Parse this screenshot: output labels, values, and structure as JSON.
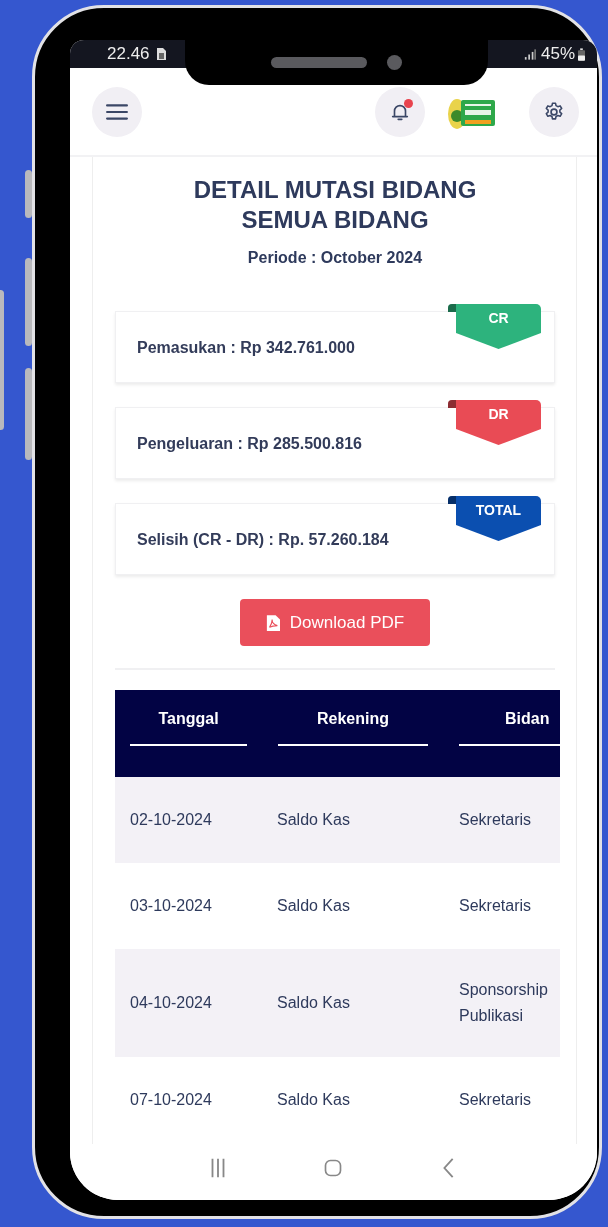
{
  "status_bar": {
    "time": "22.46",
    "battery": "45%"
  },
  "header": {
    "notification_unread": true
  },
  "report": {
    "title": "DETAIL MUTASI BIDANG",
    "subtitle": "SEMUA BIDANG",
    "period": "Periode : October 2024"
  },
  "summary": [
    {
      "text": "Pemasukan : Rp 342.761.000",
      "tag": "CR",
      "color": "#2db37d"
    },
    {
      "text": "Pengeluaran : Rp 285.500.816",
      "tag": "DR",
      "color": "#e94b55"
    },
    {
      "text": "Selisih (CR - DR) : Rp. 57.260.184",
      "tag": "TOTAL",
      "color": "#0b4fb0"
    }
  ],
  "download_button": "Download PDF",
  "table": {
    "columns": [
      "Tanggal",
      "Rekening",
      "Bidan"
    ],
    "rows": [
      [
        "02-10-2024",
        "Saldo Kas",
        "Sekretaris"
      ],
      [
        "03-10-2024",
        "Saldo Kas",
        "Sekretaris"
      ],
      [
        "04-10-2024",
        "Saldo Kas",
        "Sponsorship Publikasi"
      ],
      [
        "07-10-2024",
        "Saldo Kas",
        "Sekretaris"
      ]
    ]
  }
}
